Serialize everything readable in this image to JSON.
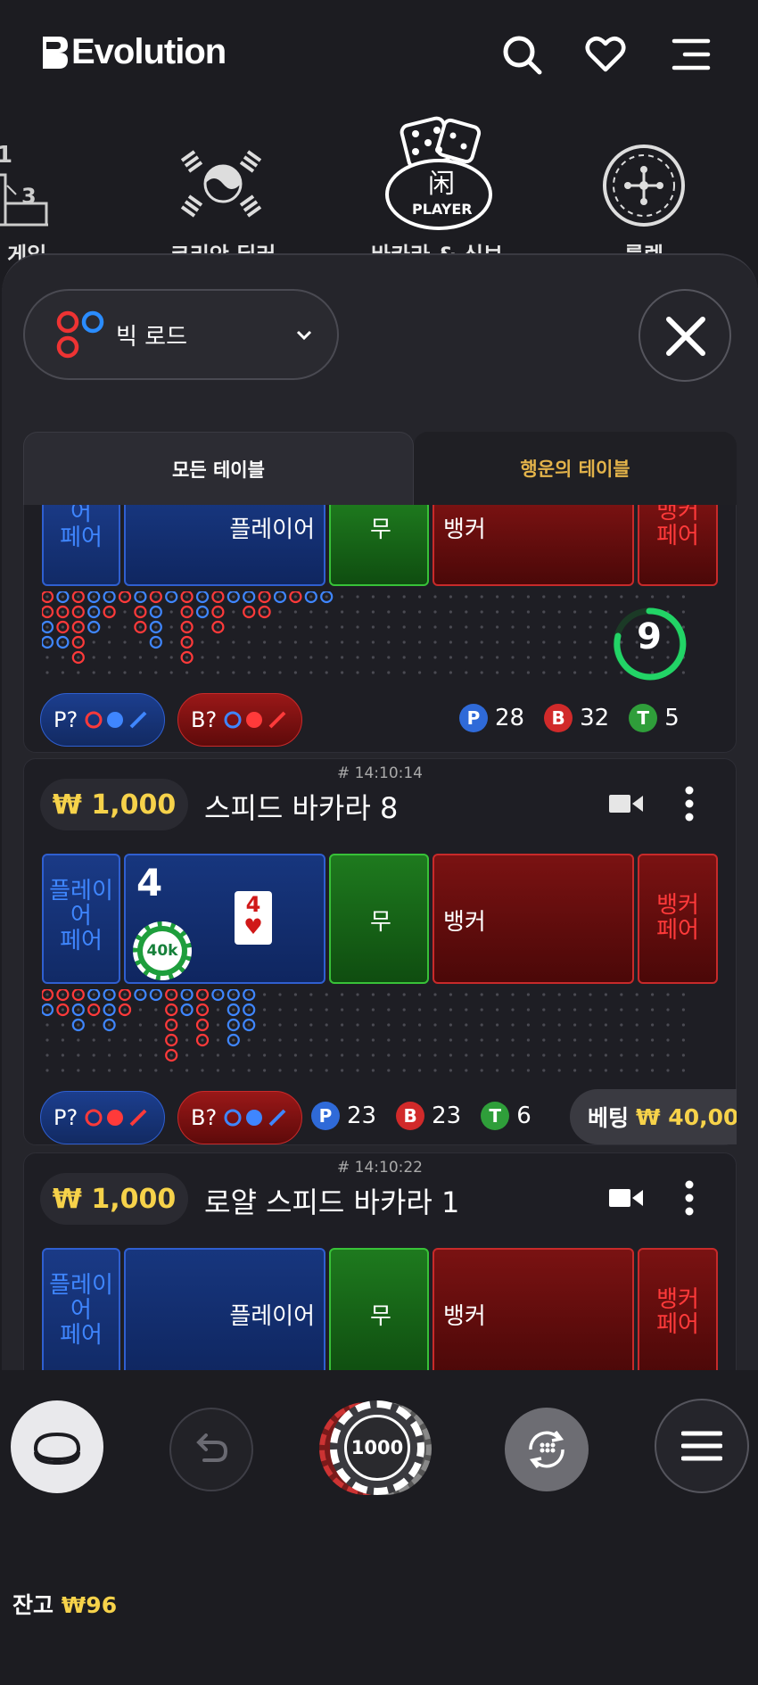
{
  "header": {
    "brand": "Evolution",
    "icons": [
      "search-icon",
      "heart-icon",
      "menu-icon"
    ]
  },
  "categories": [
    {
      "label": "의 게임",
      "icon": "podium-icon"
    },
    {
      "label": "코리안 딜러",
      "icon": "korea-flag-icon"
    },
    {
      "label": "바카라 & 식보",
      "icon": "dice-player-icon"
    },
    {
      "label": "룰렛",
      "icon": "roulette-icon"
    }
  ],
  "road_selector": {
    "label": "빅 로드",
    "icon": "big-road-icon"
  },
  "tabs": {
    "all": "모든 테이블",
    "lucky": "행운의 테이블"
  },
  "bet_labels": {
    "player_pair": [
      "플레이",
      "어",
      "페어"
    ],
    "player": "플레이어",
    "tie": "무",
    "banker": "뱅커",
    "banker_pair": [
      "뱅커",
      "페어"
    ]
  },
  "table_top": {
    "countdown": "9",
    "stats": {
      "p": "28",
      "b": "32",
      "t": "5"
    },
    "ask_p": "P?",
    "ask_b": "B?"
  },
  "table_2": {
    "round_id": "# 14:10:14",
    "limit": "₩ 1,000",
    "name": "스피드 바카라 8",
    "player_score": "4",
    "card_rank": "4",
    "card_suit": "♥",
    "chip_value": "40k",
    "stats": {
      "p": "23",
      "b": "23",
      "t": "6"
    },
    "ask_p": "P?",
    "ask_b": "B?",
    "bet_label": "베팅",
    "bet_amount": "₩ 40,00"
  },
  "table_3": {
    "round_id": "# 14:10:22",
    "limit": "₩ 1,000",
    "name": "로얄 스피드 바카라 1"
  },
  "stat_letters": {
    "p": "P",
    "b": "B",
    "t": "T"
  },
  "controls": {
    "chip": "1000",
    "balance_label": "잔고",
    "balance_value": "₩96"
  },
  "colors": {
    "player": "#2f5fd0",
    "banker": "#c82a2a",
    "tie": "#38c238",
    "gold": "#f6d24a",
    "lucky_tab": "#e3b34a"
  }
}
